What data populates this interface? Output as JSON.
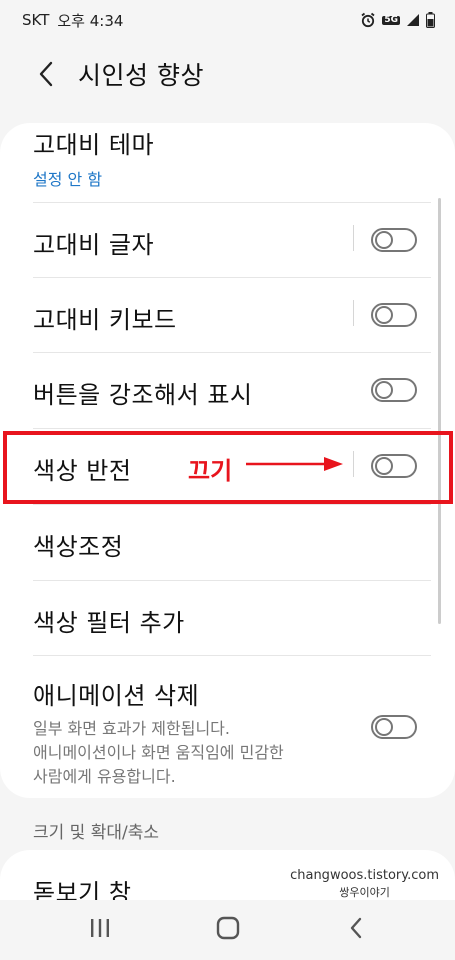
{
  "status_bar": {
    "carrier": "SKT",
    "time": "오후 4:34",
    "network": "5G"
  },
  "header": {
    "title": "시인성 향상"
  },
  "settings": {
    "high_contrast_theme": {
      "title": "고대비 테마",
      "status": "설정 안 함"
    },
    "high_contrast_text": {
      "title": "고대비 글자",
      "enabled": false
    },
    "high_contrast_keyboard": {
      "title": "고대비 키보드",
      "enabled": false
    },
    "highlight_buttons": {
      "title": "버튼을 강조해서 표시",
      "enabled": false
    },
    "color_inversion": {
      "title": "색상 반전",
      "enabled": false
    },
    "color_adjustment": {
      "title": "색상조정"
    },
    "color_filter": {
      "title": "색상 필터 추가"
    },
    "remove_animations": {
      "title": "애니메이션 삭제",
      "description_line1": "일부 화면 효과가 제한됩니다.",
      "description_line2": "애니메이션이나 화면 움직임에 민감한",
      "description_line3": "사람에게 유용합니다.",
      "enabled": false
    }
  },
  "annotation": {
    "label": "끄기",
    "color": "#e8141d"
  },
  "section2": {
    "label": "크기 및 확대/축소",
    "magnifier_title": "돋보기 창"
  },
  "watermark": {
    "line1": "changwoos.tistory.com",
    "line2": "쌍우이야기"
  },
  "colors": {
    "accent_link": "#1f77c7",
    "toggle_off": "#767676"
  }
}
